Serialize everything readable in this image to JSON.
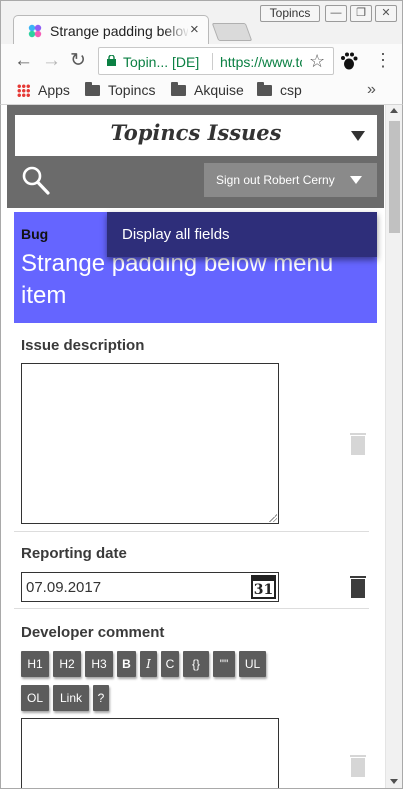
{
  "browser": {
    "tab": {
      "title": "Strange padding below menu item",
      "close": "×"
    },
    "profile": "Topincs",
    "window_controls": [
      "—",
      "❐",
      "✕"
    ],
    "nav": {
      "back": "←",
      "forward": "→",
      "reload": "↻"
    },
    "omnibox": {
      "secure_label": "Topin... [DE]",
      "url": "https://www.topincs.com",
      "star": "☆"
    },
    "menu": "⋮",
    "bookmarks": [
      {
        "label": "Apps",
        "icon": "apps-grid-icon"
      },
      {
        "label": "Topincs",
        "icon": "folder-icon"
      },
      {
        "label": "Akquise",
        "icon": "folder-icon"
      },
      {
        "label": "csp",
        "icon": "folder-icon"
      }
    ],
    "bookmarks_more": "»"
  },
  "app": {
    "title": "Topincs Issues",
    "signout": "Sign out Robert Cerny",
    "popup_item": "Display all fields"
  },
  "issue": {
    "type": "Bug",
    "title": "Strange padding below menu item"
  },
  "fields": {
    "description_label": "Issue description",
    "description_value": "",
    "reporting_date_label": "Reporting date",
    "reporting_date_value": "07.09.2017",
    "calendar_day": "31",
    "developer_comment_label": "Developer comment",
    "developer_comment_value": ""
  },
  "editor_toolbar": [
    "H1",
    "H2",
    "H3",
    "B",
    "I",
    "C",
    "{}",
    "\"\"",
    "UL",
    "OL",
    "Link",
    "?"
  ],
  "colors": {
    "header_bg": "#6b6b6b",
    "issue_banner": "#6565ff",
    "popup_bg": "#2e2e7a",
    "secure_green": "#0b8043"
  }
}
